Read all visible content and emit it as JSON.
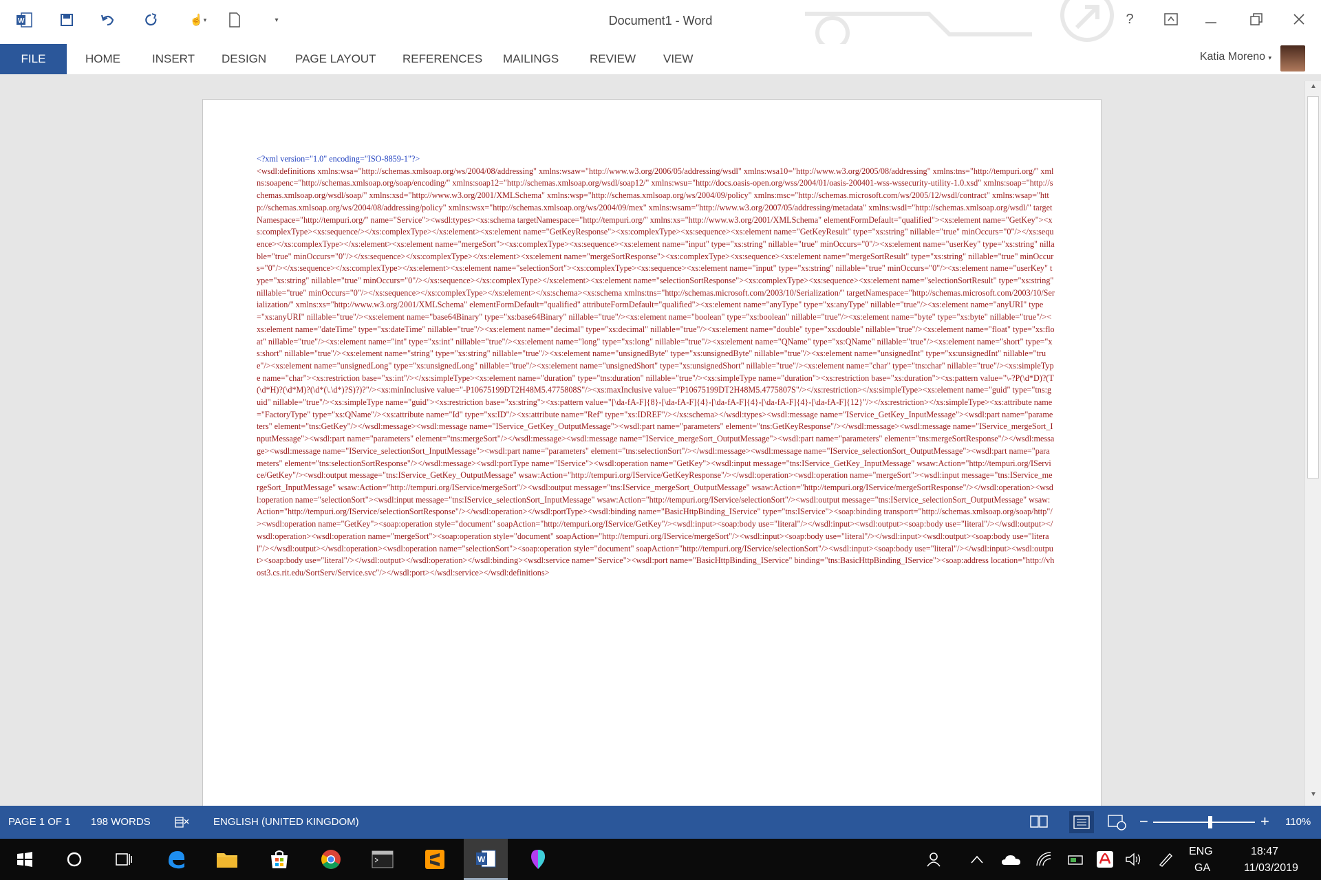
{
  "window": {
    "title": "Document1 - Word",
    "help": "?"
  },
  "ribbon": {
    "file": "FILE",
    "tabs": [
      "HOME",
      "INSERT",
      "DESIGN",
      "PAGE LAYOUT",
      "REFERENCES",
      "MAILINGS",
      "REVIEW",
      "VIEW"
    ],
    "user": "Katia Moreno"
  },
  "doc": {
    "line1": "<?xml version=\"1.0\" encoding=\"ISO-8859-1\"?>",
    "body": "<wsdl:definitions xmlns:wsa=\"http://schemas.xmlsoap.org/ws/2004/08/addressing\" xmlns:wsaw=\"http://www.w3.org/2006/05/addressing/wsdl\" xmlns:wsa10=\"http://www.w3.org/2005/08/addressing\" xmlns:tns=\"http://tempuri.org/\" xmlns:soapenc=\"http://schemas.xmlsoap.org/soap/encoding/\" xmlns:soap12=\"http://schemas.xmlsoap.org/wsdl/soap12/\" xmlns:wsu=\"http://docs.oasis-open.org/wss/2004/01/oasis-200401-wss-wssecurity-utility-1.0.xsd\" xmlns:soap=\"http://schemas.xmlsoap.org/wsdl/soap/\" xmlns:xsd=\"http://www.w3.org/2001/XMLSchema\" xmlns:wsp=\"http://schemas.xmlsoap.org/ws/2004/09/policy\" xmlns:msc=\"http://schemas.microsoft.com/ws/2005/12/wsdl/contract\" xmlns:wsap=\"http://schemas.xmlsoap.org/ws/2004/08/addressing/policy\" xmlns:wsx=\"http://schemas.xmlsoap.org/ws/2004/09/mex\" xmlns:wsam=\"http://www.w3.org/2007/05/addressing/metadata\" xmlns:wsdl=\"http://schemas.xmlsoap.org/wsdl/\" targetNamespace=\"http://tempuri.org/\" name=\"Service\"><wsdl:types><xs:schema targetNamespace=\"http://tempuri.org/\" xmlns:xs=\"http://www.w3.org/2001/XMLSchema\" elementFormDefault=\"qualified\"><xs:element name=\"GetKey\"><xs:complexType><xs:sequence/></xs:complexType></xs:element><xs:element name=\"GetKeyResponse\"><xs:complexType><xs:sequence><xs:element name=\"GetKeyResult\" type=\"xs:string\" nillable=\"true\" minOccurs=\"0\"/></xs:sequence></xs:complexType></xs:element><xs:element name=\"mergeSort\"><xs:complexType><xs:sequence><xs:element name=\"input\" type=\"xs:string\" nillable=\"true\" minOccurs=\"0\"/><xs:element name=\"userKey\" type=\"xs:string\" nillable=\"true\" minOccurs=\"0\"/></xs:sequence></xs:complexType></xs:element><xs:element name=\"mergeSortResponse\"><xs:complexType><xs:sequence><xs:element name=\"mergeSortResult\" type=\"xs:string\" nillable=\"true\" minOccurs=\"0\"/></xs:sequence></xs:complexType></xs:element><xs:element name=\"selectionSort\"><xs:complexType><xs:sequence><xs:element name=\"input\" type=\"xs:string\" nillable=\"true\" minOccurs=\"0\"/><xs:element name=\"userKey\" type=\"xs:string\" nillable=\"true\" minOccurs=\"0\"/></xs:sequence></xs:complexType></xs:element><xs:element name=\"selectionSortResponse\"><xs:complexType><xs:sequence><xs:element name=\"selectionSortResult\" type=\"xs:string\" nillable=\"true\" minOccurs=\"0\"/></xs:sequence></xs:complexType></xs:element></xs:schema><xs:schema xmlns:tns=\"http://schemas.microsoft.com/2003/10/Serialization/\" targetNamespace=\"http://schemas.microsoft.com/2003/10/Serialization/\" xmlns:xs=\"http://www.w3.org/2001/XMLSchema\" elementFormDefault=\"qualified\" attributeFormDefault=\"qualified\"><xs:element name=\"anyType\" type=\"xs:anyType\" nillable=\"true\"/><xs:element name=\"anyURI\" type=\"xs:anyURI\" nillable=\"true\"/><xs:element name=\"base64Binary\" type=\"xs:base64Binary\" nillable=\"true\"/><xs:element name=\"boolean\" type=\"xs:boolean\" nillable=\"true\"/><xs:element name=\"byte\" type=\"xs:byte\" nillable=\"true\"/><xs:element name=\"dateTime\" type=\"xs:dateTime\" nillable=\"true\"/><xs:element name=\"decimal\" type=\"xs:decimal\" nillable=\"true\"/><xs:element name=\"double\" type=\"xs:double\" nillable=\"true\"/><xs:element name=\"float\" type=\"xs:float\" nillable=\"true\"/><xs:element name=\"int\" type=\"xs:int\" nillable=\"true\"/><xs:element name=\"long\" type=\"xs:long\" nillable=\"true\"/><xs:element name=\"QName\" type=\"xs:QName\" nillable=\"true\"/><xs:element name=\"short\" type=\"xs:short\" nillable=\"true\"/><xs:element name=\"string\" type=\"xs:string\" nillable=\"true\"/><xs:element name=\"unsignedByte\" type=\"xs:unsignedByte\" nillable=\"true\"/><xs:element name=\"unsignedInt\" type=\"xs:unsignedInt\" nillable=\"true\"/><xs:element name=\"unsignedLong\" type=\"xs:unsignedLong\" nillable=\"true\"/><xs:element name=\"unsignedShort\" type=\"xs:unsignedShort\" nillable=\"true\"/><xs:element name=\"char\" type=\"tns:char\" nillable=\"true\"/><xs:simpleType name=\"char\"><xs:restriction base=\"xs:int\"/></xs:simpleType><xs:element name=\"duration\" type=\"tns:duration\" nillable=\"true\"/><xs:simpleType name=\"duration\"><xs:restriction base=\"xs:duration\"><xs:pattern value=\"\\-?P(\\d*D)?(T(\\d*H)?(\\d*M)?(\\d*(\\.\\d*)?S)?)?\"/><xs:minInclusive value=\"-P10675199DT2H48M5.4775808S\"/><xs:maxInclusive value=\"P10675199DT2H48M5.4775807S\"/></xs:restriction></xs:simpleType><xs:element name=\"guid\" type=\"tns:guid\" nillable=\"true\"/><xs:simpleType name=\"guid\"><xs:restriction base=\"xs:string\"><xs:pattern value=\"[\\da-fA-F]{8}-[\\da-fA-F]{4}-[\\da-fA-F]{4}-[\\da-fA-F]{4}-[\\da-fA-F]{12}\"/></xs:restriction></xs:simpleType><xs:attribute name=\"FactoryType\" type=\"xs:QName\"/><xs:attribute name=\"Id\" type=\"xs:ID\"/><xs:attribute name=\"Ref\" type=\"xs:IDREF\"/></xs:schema></wsdl:types><wsdl:message name=\"IService_GetKey_InputMessage\"><wsdl:part name=\"parameters\" element=\"tns:GetKey\"/></wsdl:message><wsdl:message name=\"IService_GetKey_OutputMessage\"><wsdl:part name=\"parameters\" element=\"tns:GetKeyResponse\"/></wsdl:message><wsdl:message name=\"IService_mergeSort_InputMessage\"><wsdl:part name=\"parameters\" element=\"tns:mergeSort\"/></wsdl:message><wsdl:message name=\"IService_mergeSort_OutputMessage\"><wsdl:part name=\"parameters\" element=\"tns:mergeSortResponse\"/></wsdl:message><wsdl:message name=\"IService_selectionSort_InputMessage\"><wsdl:part name=\"parameters\" element=\"tns:selectionSort\"/></wsdl:message><wsdl:message name=\"IService_selectionSort_OutputMessage\"><wsdl:part name=\"parameters\" element=\"tns:selectionSortResponse\"/></wsdl:message><wsdl:portType name=\"IService\"><wsdl:operation name=\"GetKey\"><wsdl:input message=\"tns:IService_GetKey_InputMessage\" wsaw:Action=\"http://tempuri.org/IService/GetKey\"/><wsdl:output message=\"tns:IService_GetKey_OutputMessage\" wsaw:Action=\"http://tempuri.org/IService/GetKeyResponse\"/></wsdl:operation><wsdl:operation name=\"mergeSort\"><wsdl:input message=\"tns:IService_mergeSort_InputMessage\" wsaw:Action=\"http://tempuri.org/IService/mergeSort\"/><wsdl:output message=\"tns:IService_mergeSort_OutputMessage\" wsaw:Action=\"http://tempuri.org/IService/mergeSortResponse\"/></wsdl:operation><wsdl:operation name=\"selectionSort\"><wsdl:input message=\"tns:IService_selectionSort_InputMessage\" wsaw:Action=\"http://tempuri.org/IService/selectionSort\"/><wsdl:output message=\"tns:IService_selectionSort_OutputMessage\" wsaw:Action=\"http://tempuri.org/IService/selectionSortResponse\"/></wsdl:operation></wsdl:portType><wsdl:binding name=\"BasicHttpBinding_IService\" type=\"tns:IService\"><soap:binding transport=\"http://schemas.xmlsoap.org/soap/http\"/><wsdl:operation name=\"GetKey\"><soap:operation style=\"document\" soapAction=\"http://tempuri.org/IService/GetKey\"/><wsdl:input><soap:body use=\"literal\"/></wsdl:input><wsdl:output><soap:body use=\"literal\"/></wsdl:output></wsdl:operation><wsdl:operation name=\"mergeSort\"><soap:operation style=\"document\" soapAction=\"http://tempuri.org/IService/mergeSort\"/><wsdl:input><soap:body use=\"literal\"/></wsdl:input><wsdl:output><soap:body use=\"literal\"/></wsdl:output></wsdl:operation><wsdl:operation name=\"selectionSort\"><soap:operation style=\"document\" soapAction=\"http://tempuri.org/IService/selectionSort\"/><wsdl:input><soap:body use=\"literal\"/></wsdl:input><wsdl:output><soap:body use=\"literal\"/></wsdl:output></wsdl:operation></wsdl:binding><wsdl:service name=\"Service\"><wsdl:port name=\"BasicHttpBinding_IService\" binding=\"tns:BasicHttpBinding_IService\"><soap:address location=\"http://vhost3.cs.rit.edu/SortServ/Service.svc\"/></wsdl:port></wsdl:service></wsdl:definitions>"
  },
  "status": {
    "page": "PAGE 1 OF 1",
    "words": "198 WORDS",
    "language": "ENGLISH (UNITED KINGDOM)",
    "zoom": "110%",
    "zoom_value": 1.1
  },
  "tray": {
    "lang1": "ENG",
    "lang2": "GA",
    "time": "18:47",
    "date": "11/03/2019"
  },
  "colors": {
    "accent": "#2b579a",
    "text_dark_red": "#9b1c1c",
    "decl_blue": "#1f3fbf"
  }
}
